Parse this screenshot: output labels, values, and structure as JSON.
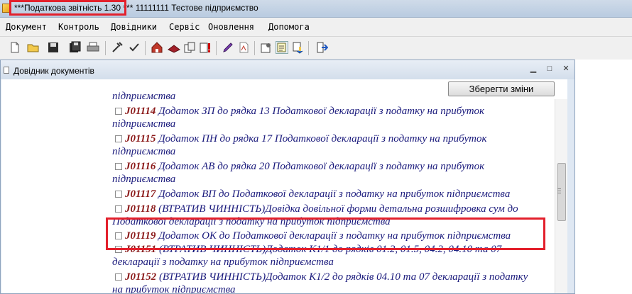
{
  "window": {
    "title": "***Податкова звітність 1.30 *** 11111111 Тестове підприємство"
  },
  "menu": {
    "items": [
      "Документ",
      "Контроль",
      "Довідники",
      "Сервіс",
      "Оновлення",
      "Допомога"
    ]
  },
  "toolbar": {
    "icons": [
      "new-document-icon",
      "open-folder-icon",
      "save-icon",
      "save-all-icon",
      "print-icon",
      "tools-icon",
      "home-icon",
      "books-icon",
      "copy-icon",
      "alert-icon",
      "pen-icon",
      "pdf-icon",
      "settings-icon",
      "forms-icon",
      "send-icon",
      "exit-icon"
    ]
  },
  "dialog": {
    "title": "Довідник документів",
    "save_button": "Зберегти зміни",
    "items": [
      {
        "code": "",
        "text": "підприємства"
      },
      {
        "code": "J01114",
        "text": "Додаток ЗП до рядка 13 Податкової декларації з податку на прибуток"
      },
      {
        "code": "",
        "text": "підприємства"
      },
      {
        "code": "J01115",
        "text": "Додаток ПН до рядка 17 Податкової декларації з податку на прибуток"
      },
      {
        "code": "",
        "text": "підприємства"
      },
      {
        "code": "J01116",
        "text": "Додаток АВ до рядка 20 Податкової декларації з податку на прибуток"
      },
      {
        "code": "",
        "text": "підприємства"
      },
      {
        "code": "J01117",
        "text": "Додаток ВП до Податкової декларації з податку на прибуток підприємства"
      },
      {
        "code": "J01118",
        "text": "(ВТРАТИВ ЧИННІСТЬ)Довідка довільної форми детальна розшифровка сум до"
      },
      {
        "code": "",
        "text": "Податкової декларації з податку на прибуток підприємства"
      },
      {
        "code": "J01119",
        "text": "Додаток ОК до Податкової декларації з податку на прибуток підприємства"
      },
      {
        "code": "J01151",
        "text": "(ВТРАТИВ ЧИННІСТЬ)Додаток К1/1 до рядків 01.2, 01.5, 04.2, 04.10 та 07"
      },
      {
        "code": "",
        "text": "декларації з податку на прибуток підприємства"
      },
      {
        "code": "J01152",
        "text": "(ВТРАТИВ ЧИННІСТЬ)Додаток К1/2 до рядків 04.10 та 07 декларації з податку"
      },
      {
        "code": "",
        "text": "на прибуток підприємства"
      }
    ]
  },
  "colors": {
    "highlight": "#e3202c",
    "code": "#8b1a1a",
    "text": "#1a1a7c"
  }
}
